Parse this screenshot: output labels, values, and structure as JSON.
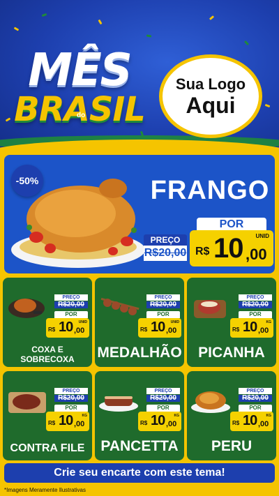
{
  "header": {
    "title_line1": "MÊS",
    "title_do": "do",
    "title_line2": "BRASIL",
    "logo_line1": "Sua Logo",
    "logo_line2": "Aqui"
  },
  "hero": {
    "discount": "-50%",
    "name": "FRANGO",
    "old_label": "PREÇO",
    "old_price": "R$20,00",
    "new_label": "POR",
    "currency": "R$",
    "price_int": "10",
    "price_cents": ",00",
    "unit": "UNID"
  },
  "products": [
    {
      "name": "COXA E SOBRECOXA",
      "preco_label": "PREÇO",
      "old_price": "R$20,00",
      "por_label": "POR",
      "currency": "R$",
      "price_int": "10",
      "price_cents": ",00",
      "unit": "UNID"
    },
    {
      "name": "MEDALHÃO",
      "preco_label": "PREÇO",
      "old_price": "R$20,00",
      "por_label": "POR",
      "currency": "R$",
      "price_int": "10",
      "price_cents": ",00",
      "unit": "UNID"
    },
    {
      "name": "PICANHA",
      "preco_label": "PREÇO",
      "old_price": "R$20,00",
      "por_label": "POR",
      "currency": "R$",
      "price_int": "10",
      "price_cents": ",00",
      "unit": "KG"
    },
    {
      "name": "CONTRA FILE",
      "preco_label": "PREÇO",
      "old_price": "R$20,00",
      "por_label": "POR",
      "currency": "R$",
      "price_int": "10",
      "price_cents": ",00",
      "unit": "KG"
    },
    {
      "name": "PANCETTA",
      "preco_label": "PREÇO",
      "old_price": "R$20,00",
      "por_label": "POR",
      "currency": "R$",
      "price_int": "10",
      "price_cents": ",00",
      "unit": "KG"
    },
    {
      "name": "PERU",
      "preco_label": "PREÇO",
      "old_price": "R$20,00",
      "por_label": "POR",
      "currency": "R$",
      "price_int": "10",
      "price_cents": ",00",
      "unit": "KG"
    }
  ],
  "cta": "Crie seu encarte com este tema!",
  "footnote": "*Imagens Meramente Ilustrativas",
  "colors": {
    "blue": "#1d3fae",
    "yellow": "#f5c400",
    "green": "#1f6b2c"
  }
}
